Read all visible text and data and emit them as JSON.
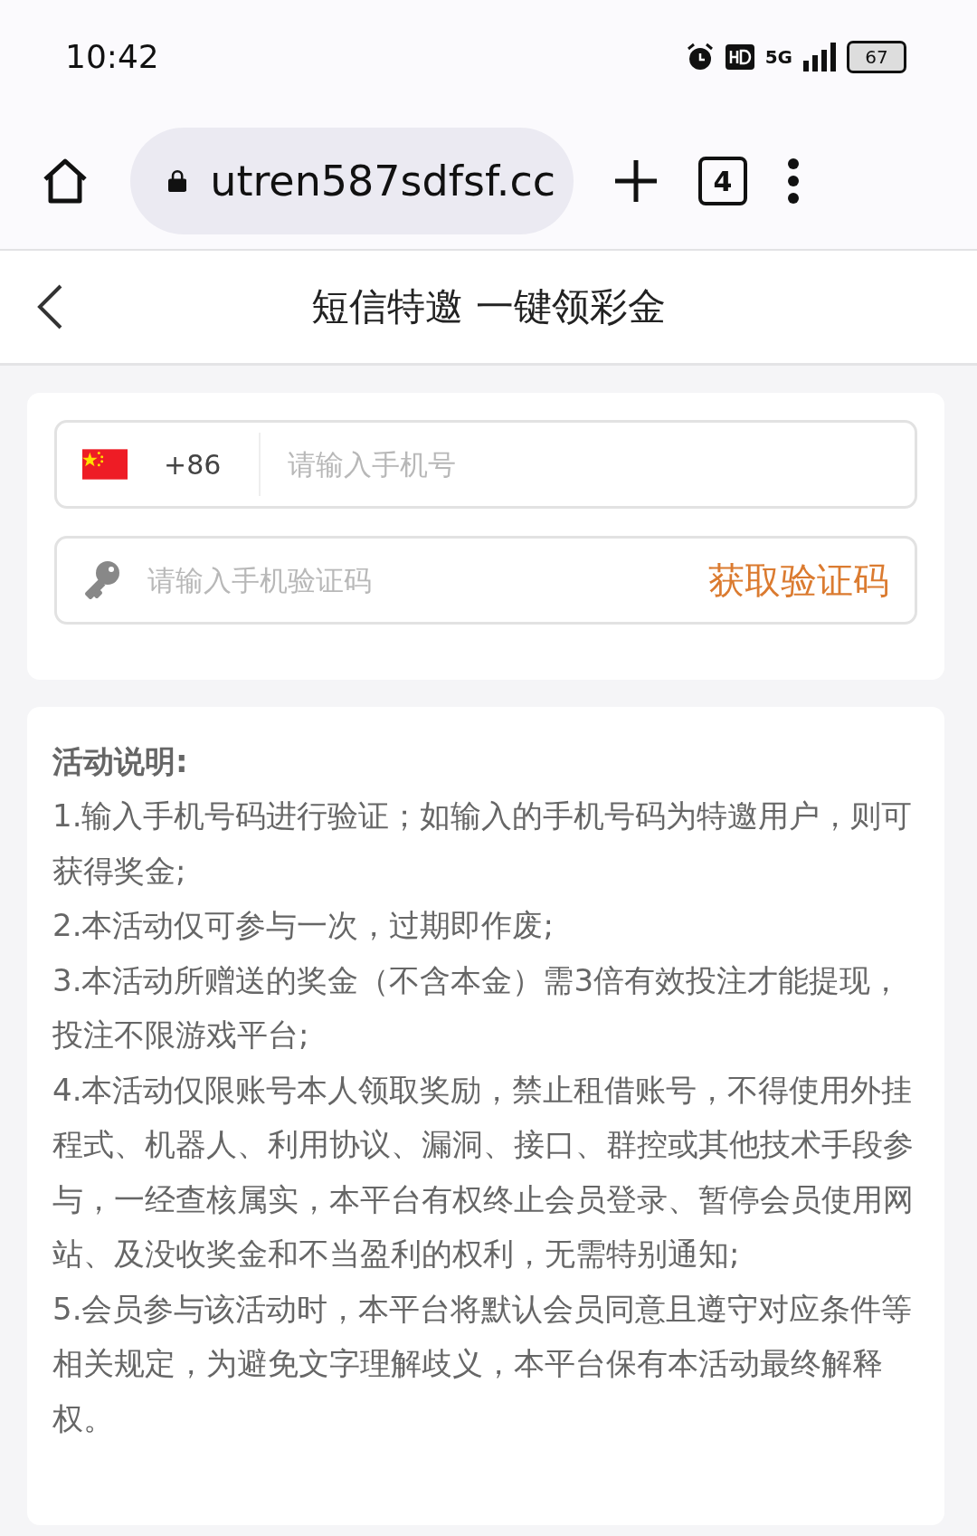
{
  "status_bar": {
    "time": "10:42",
    "network": "5G",
    "battery": "67"
  },
  "browser": {
    "url": "utren587sdfsf.cc",
    "tab_count": "4"
  },
  "header": {
    "title": "短信特邀 一键领彩金"
  },
  "form": {
    "country_code": "+86",
    "phone": {
      "placeholder": "请输入手机号"
    },
    "code": {
      "placeholder": "请输入手机验证码"
    },
    "get_code_button": "获取验证码"
  },
  "rules": {
    "heading": "活动说明:",
    "items": [
      "1.输入手机号码进行验证；如输入的手机号码为特邀用户，则可获得奖金;",
      "2.本活动仅可参与一次，过期即作废;",
      "3.本活动所赠送的奖金（不含本金）需3倍有效投注才能提现，投注不限游戏平台;",
      "4.本活动仅限账号本人领取奖励，禁止租借账号，不得使用外挂程式、机器人、利用协议、漏洞、接口、群控或其他技术手段参与，一经查核属实，本平台有权终止会员登录、暂停会员使用网站、及没收奖金和不当盈利的权利，无需特别通知;",
      "5.会员参与该活动时，本平台将默认会员同意且遵守对应条件等相关规定，为避免文字理解歧义，本平台保有本活动最终解释权。"
    ]
  }
}
